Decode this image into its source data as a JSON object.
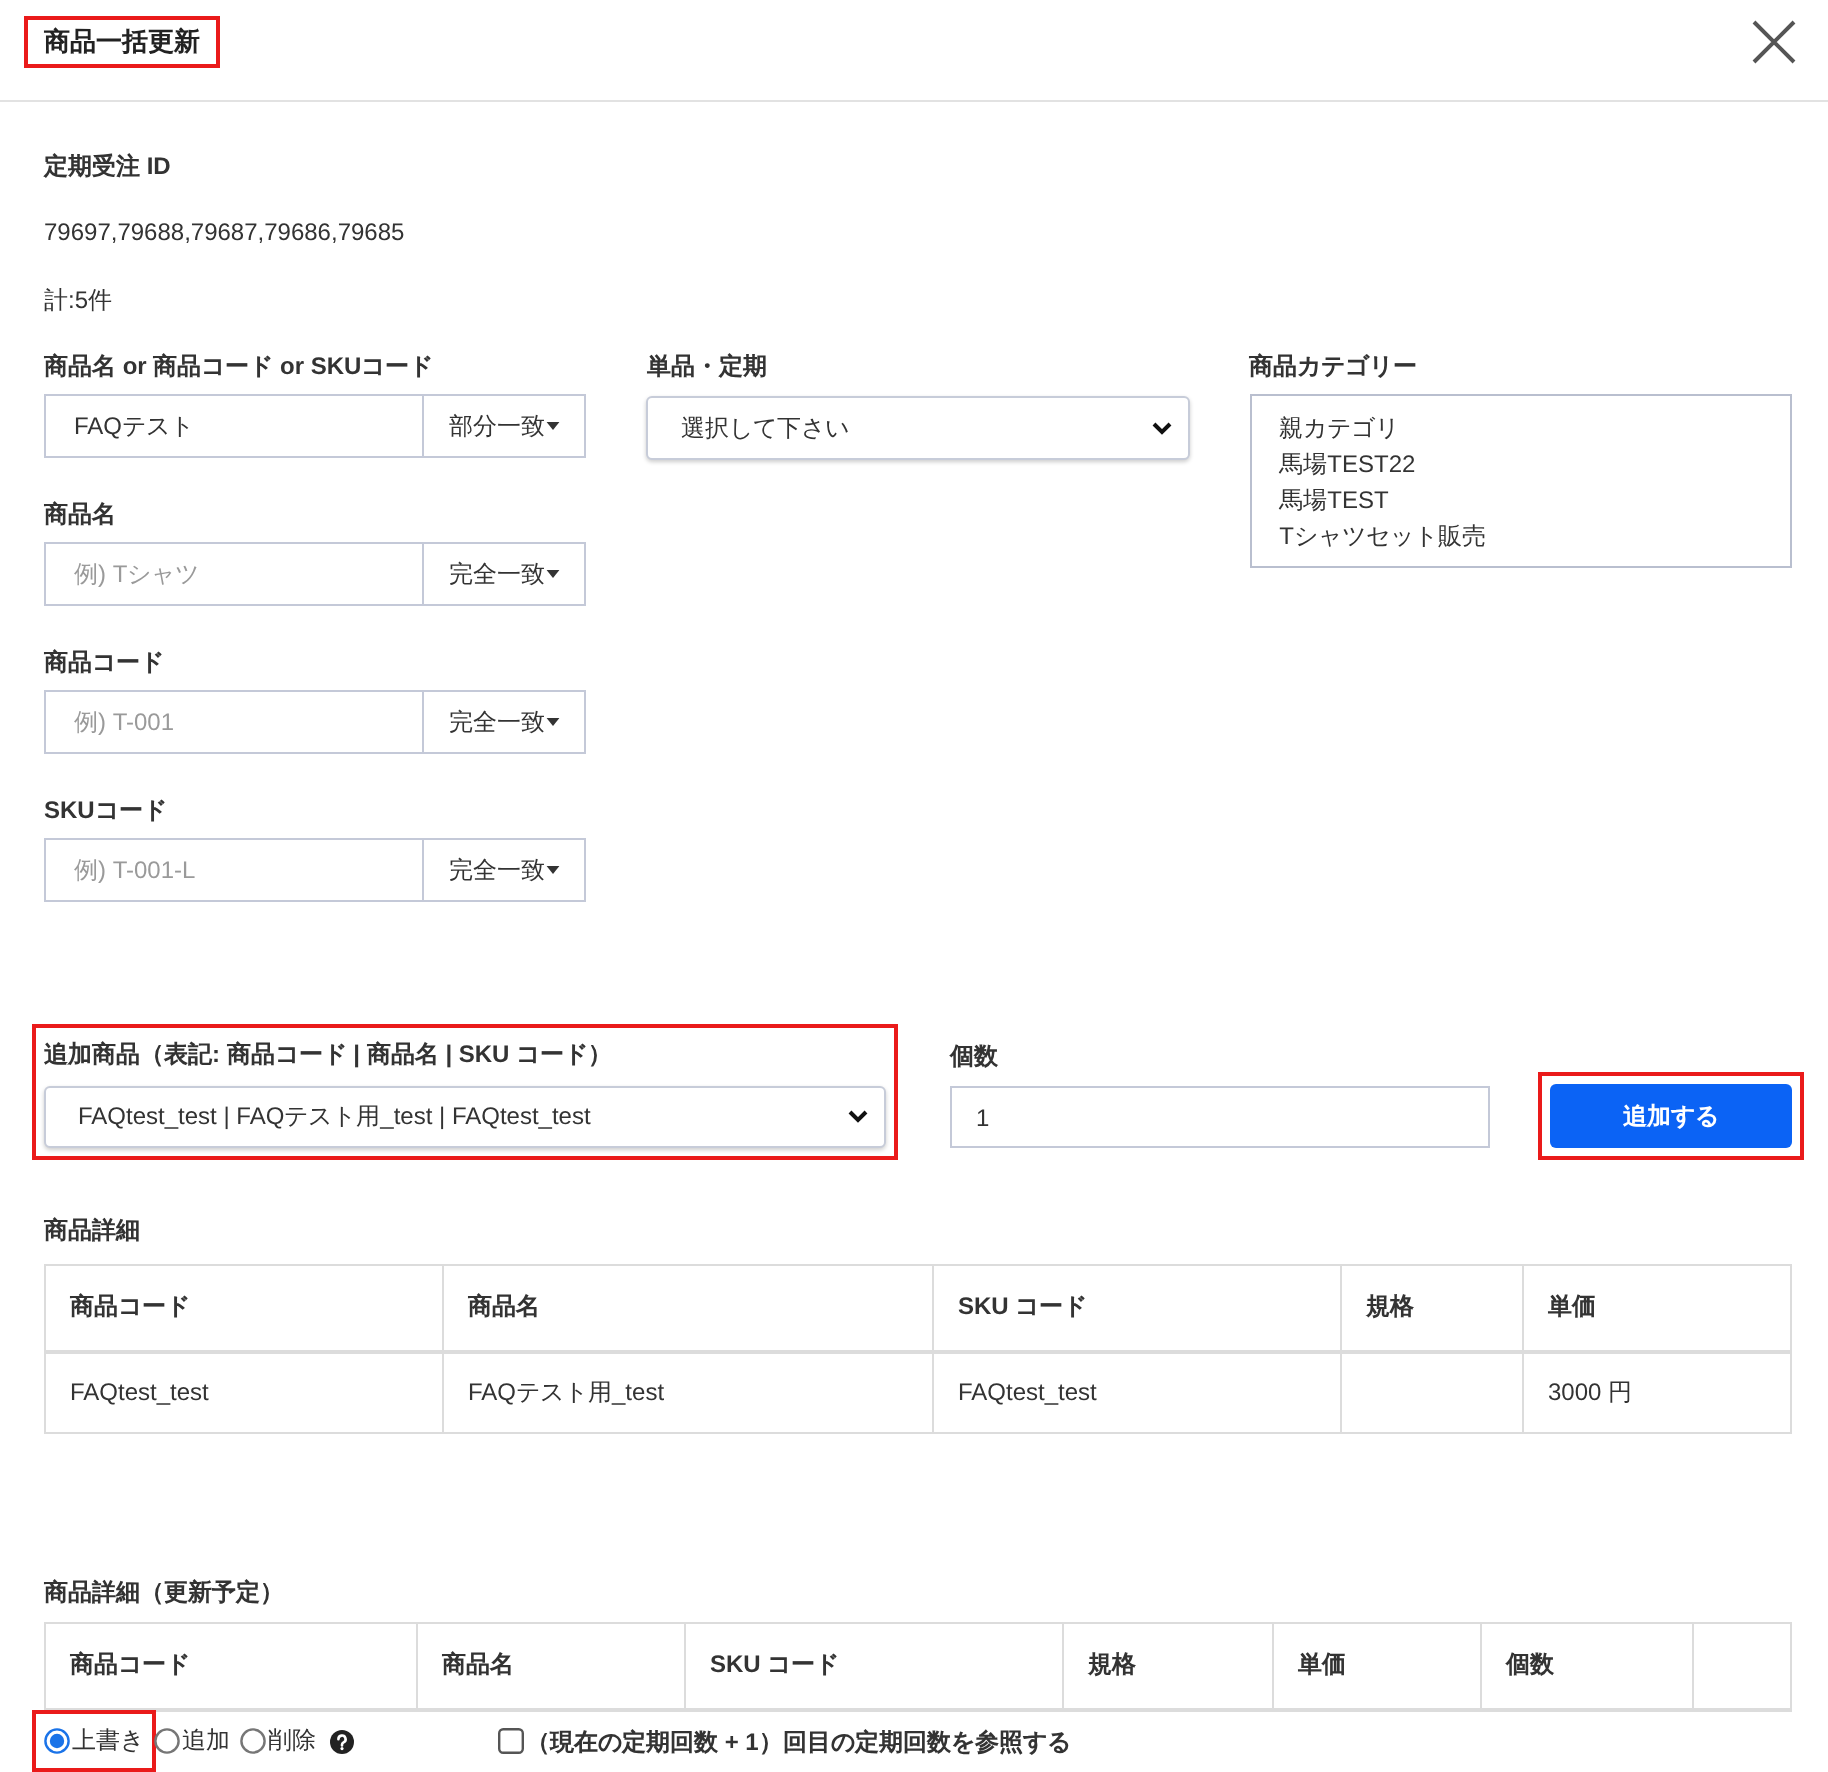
{
  "dialog": {
    "title": {
      "text": "商品一括更新",
      "highlighted": true
    }
  },
  "order_ids": {
    "label": "定期受注 ID",
    "value": "79697,79688,79687,79686,79685",
    "total": "計:5件"
  },
  "filters": [
    {
      "label": "商品名 or 商品コード or SKUコード",
      "value": "FAQテスト",
      "match": "部分一致"
    },
    {
      "label": "商品名",
      "placeholder": "例) Tシャツ",
      "match": "完全一致"
    },
    {
      "label": "商品コード",
      "placeholder": "例) T-001",
      "match": "完全一致"
    },
    {
      "label": "SKUコード",
      "placeholder": "例) T-001-L",
      "match": "完全一致"
    }
  ],
  "type_select": {
    "label": "単品・定期",
    "value": "選択して下さい"
  },
  "category_list": {
    "label": "商品カテゴリー",
    "options": [
      {
        "label": "親カテゴリ",
        "selected": false
      },
      {
        "label": "馬場TEST22",
        "selected": false
      },
      {
        "label": "馬場TEST",
        "selected": false
      },
      {
        "label": "Tシャツセット販売",
        "selected": false
      }
    ]
  },
  "add_product": {
    "label": "追加商品（表記: 商品コード | 商品名 | SKU コード）",
    "value": "FAQtest_test | FAQテスト用_test | FAQtest_test",
    "highlighted": true
  },
  "quantity": {
    "label": "個数",
    "value": "1"
  },
  "add_button": {
    "label": "追加する",
    "highlighted": true
  },
  "detail_table": {
    "title": "商品詳細",
    "columns": [
      "商品コード",
      "商品名",
      "SKU コード",
      "規格",
      "単価"
    ],
    "rows": [
      [
        "FAQtest_test",
        "FAQテスト用_test",
        "FAQtest_test",
        null,
        "3000 円"
      ]
    ]
  },
  "planned_table": {
    "title": "商品詳細（更新予定）",
    "columns": [
      "商品コード",
      "商品名",
      "SKU コード",
      "規格",
      "単価",
      "個数",
      null
    ]
  },
  "mode_options": [
    {
      "label": "上書き",
      "selected": true,
      "highlighted": true
    },
    {
      "label": "追加",
      "selected": false,
      "highlighted": false
    },
    {
      "label": "削除",
      "selected": false,
      "highlighted": false
    }
  ],
  "reference_option": {
    "label": "（現在の定期回数 + 1）回目の定期回数を参照する",
    "checked": false
  }
}
